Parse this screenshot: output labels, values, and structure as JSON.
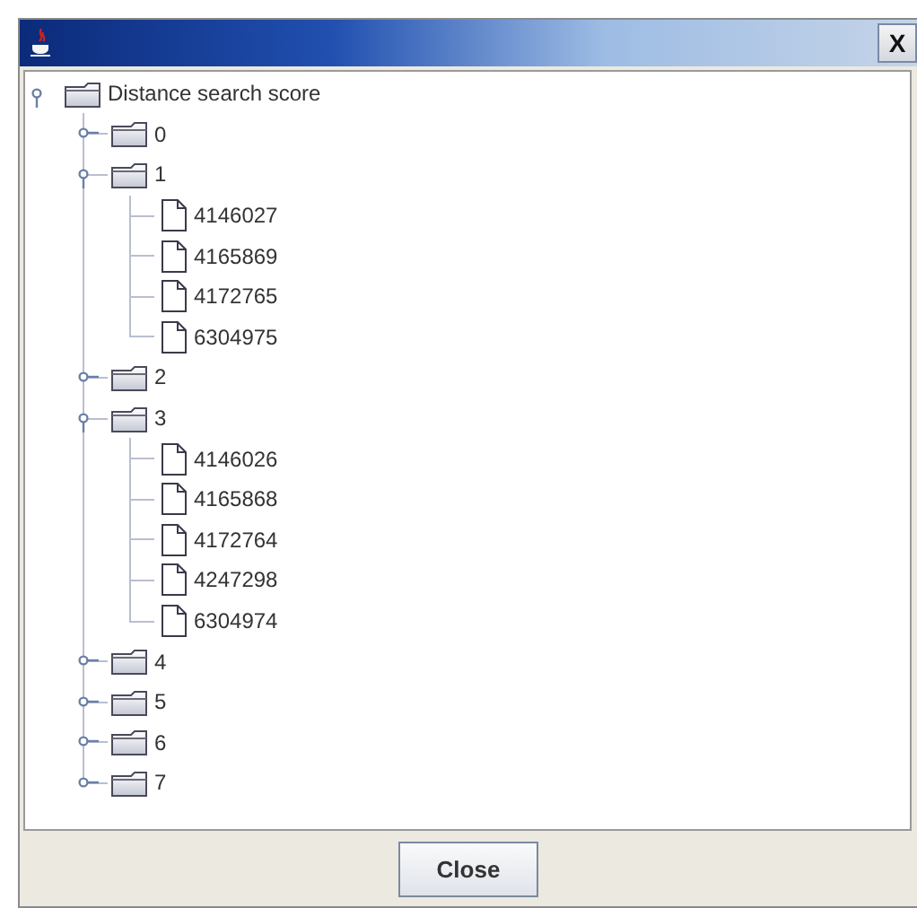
{
  "window": {
    "close_glyph": "X"
  },
  "tree": {
    "root": {
      "label": "Distance search score",
      "kind": "folder",
      "expanded": true,
      "children": [
        {
          "label": "0",
          "kind": "folder",
          "expanded": false
        },
        {
          "label": "1",
          "kind": "folder",
          "expanded": true,
          "children": [
            {
              "label": "4146027",
              "kind": "file"
            },
            {
              "label": "4165869",
              "kind": "file"
            },
            {
              "label": "4172765",
              "kind": "file"
            },
            {
              "label": "6304975",
              "kind": "file"
            }
          ]
        },
        {
          "label": "2",
          "kind": "folder",
          "expanded": false
        },
        {
          "label": "3",
          "kind": "folder",
          "expanded": true,
          "children": [
            {
              "label": "4146026",
              "kind": "file"
            },
            {
              "label": "4165868",
              "kind": "file"
            },
            {
              "label": "4172764",
              "kind": "file"
            },
            {
              "label": "4247298",
              "kind": "file"
            },
            {
              "label": "6304974",
              "kind": "file"
            }
          ]
        },
        {
          "label": "4",
          "kind": "folder",
          "expanded": false
        },
        {
          "label": "5",
          "kind": "folder",
          "expanded": false
        },
        {
          "label": "6",
          "kind": "folder",
          "expanded": false
        },
        {
          "label": "7",
          "kind": "folder",
          "expanded": false
        }
      ]
    }
  },
  "buttons": [
    {
      "label": "Close"
    }
  ]
}
